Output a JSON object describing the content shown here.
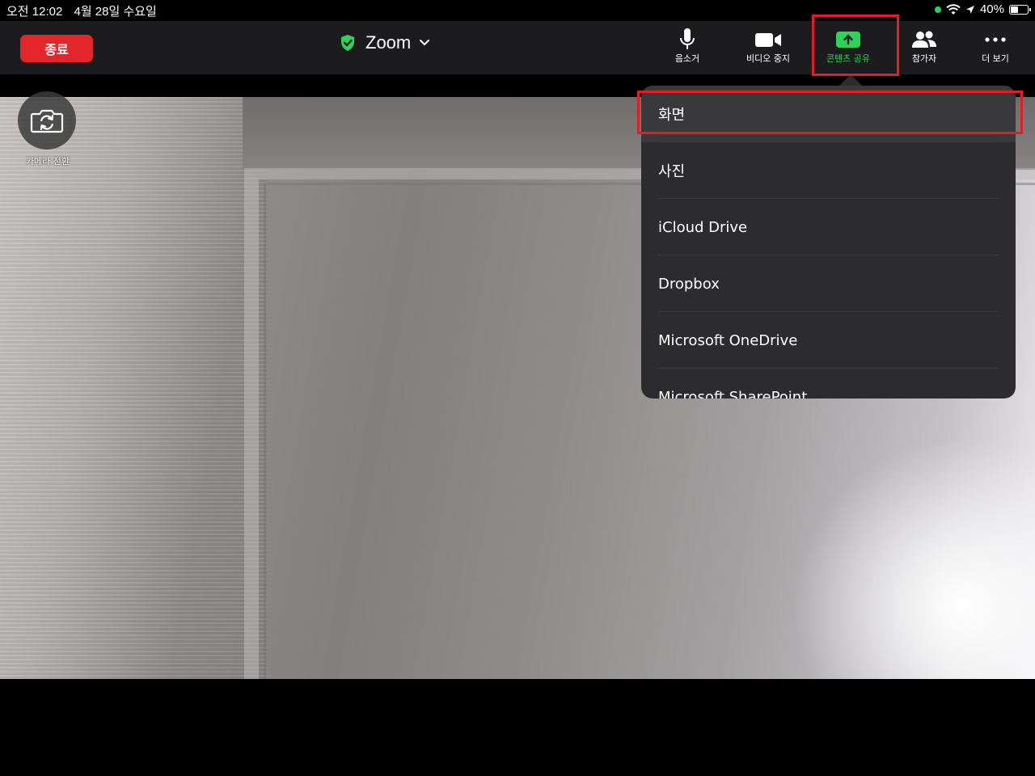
{
  "status_bar": {
    "time": "오전 12:02",
    "date": "4월 28일 수요일",
    "battery": "40%",
    "icons": [
      "green-dot",
      "wifi-icon",
      "location-arrow-icon",
      "battery-icon"
    ]
  },
  "top_bar": {
    "end_label": "종료",
    "meeting_title": "Zoom",
    "tools": [
      {
        "label": "음소거",
        "icon": "microphone-icon"
      },
      {
        "label": "비디오 중지",
        "icon": "video-camera-icon"
      },
      {
        "label": "콘텐츠 공유",
        "icon": "share-screen-icon",
        "active": true
      },
      {
        "label": "참가자",
        "icon": "participants-icon"
      },
      {
        "label": "더 보기",
        "icon": "more-icon"
      }
    ]
  },
  "camera": {
    "switch_label": "카메라 전환"
  },
  "share_menu": {
    "items": [
      "화면",
      "사진",
      "iCloud Drive",
      "Dropbox",
      "Microsoft OneDrive",
      "Microsoft SharePoint"
    ]
  },
  "colors": {
    "end_button": "#e3262b",
    "active_green": "#30d158",
    "highlight_red": "#e01e27",
    "menu_bg": "#2c2c2e"
  }
}
